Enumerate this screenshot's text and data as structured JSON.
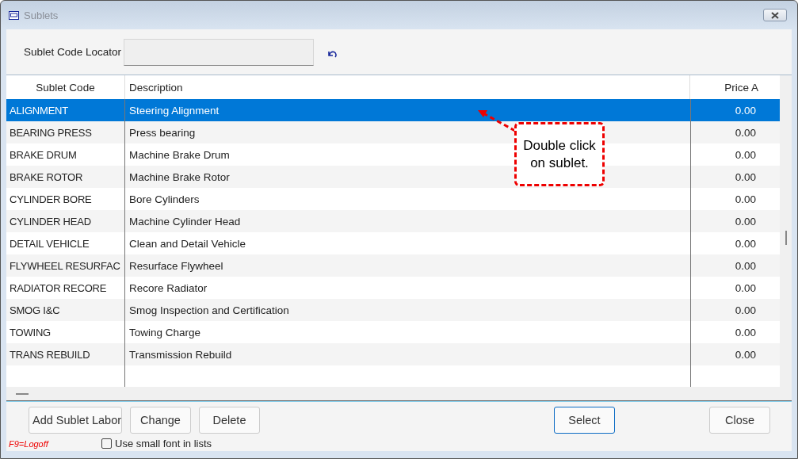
{
  "window": {
    "title": "Sublets"
  },
  "locator": {
    "label": "Sublet Code Locator"
  },
  "table": {
    "columns": [
      "Sublet Code",
      "Description",
      "Price A"
    ],
    "rows": [
      {
        "code": "ALIGNMENT",
        "description": "Steering Alignment",
        "price": "0.00",
        "selected": true
      },
      {
        "code": "BEARING PRESS",
        "description": "Press bearing",
        "price": "0.00",
        "selected": false
      },
      {
        "code": "BRAKE DRUM",
        "description": "Machine Brake Drum",
        "price": "0.00",
        "selected": false
      },
      {
        "code": "BRAKE ROTOR",
        "description": "Machine Brake Rotor",
        "price": "0.00",
        "selected": false
      },
      {
        "code": "CYLINDER BORE",
        "description": "Bore Cylinders",
        "price": "0.00",
        "selected": false
      },
      {
        "code": "CYLINDER HEAD",
        "description": "Machine Cylinder Head",
        "price": "0.00",
        "selected": false
      },
      {
        "code": "DETAIL VEHICLE",
        "description": "Clean and Detail Vehicle",
        "price": "0.00",
        "selected": false
      },
      {
        "code": "FLYWHEEL RESURFAC",
        "description": "Resurface Flywheel",
        "price": "0.00",
        "selected": false
      },
      {
        "code": "RADIATOR RECORE",
        "description": "Recore Radiator",
        "price": "0.00",
        "selected": false
      },
      {
        "code": "SMOG I&C",
        "description": "Smog Inspection and Certification",
        "price": "0.00",
        "selected": false
      },
      {
        "code": "TOWING",
        "description": "Towing Charge",
        "price": "0.00",
        "selected": false
      },
      {
        "code": "TRANS REBUILD",
        "description": "Transmission Rebuild",
        "price": "0.00",
        "selected": false
      }
    ]
  },
  "callout": {
    "text": "Double click on sublet."
  },
  "buttons": [
    {
      "label": "Add Sublet Labor",
      "default": false
    },
    {
      "label": "Change",
      "default": false
    },
    {
      "label": "Delete",
      "default": false
    },
    {
      "label": "Select",
      "default": true
    },
    {
      "label": "Close",
      "default": false
    }
  ],
  "hint": "F9=Logoff",
  "small_font": {
    "label": "Use small font in lists",
    "checked": false
  }
}
